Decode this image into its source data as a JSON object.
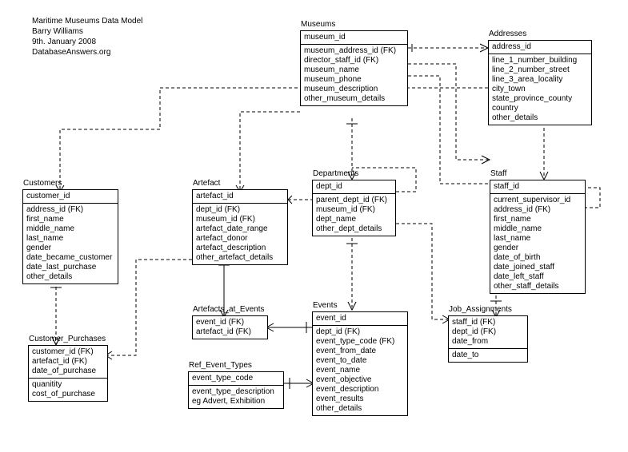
{
  "header": {
    "title": "Maritime Museums Data Model",
    "author": "Barry Williams",
    "date": "9th. January 2008",
    "site": "DatabaseAnswers.org"
  },
  "entities": {
    "museums": {
      "title": "Museums",
      "pk": [
        "museum_id"
      ],
      "attrs": [
        "museum_address_id (FK)",
        "director_staff_id (FK)",
        "museum_name",
        "museum_phone",
        "museum_description",
        "other_museum_details"
      ]
    },
    "addresses": {
      "title": "Addresses",
      "pk": [
        "address_id"
      ],
      "attrs": [
        "line_1_number_building",
        "line_2_number_street",
        "line_3_area_locality",
        "city_town",
        "state_province_county",
        "country",
        "other_details"
      ]
    },
    "customers": {
      "title": "Customers",
      "pk": [
        "customer_id"
      ],
      "attrs": [
        "address_id (FK)",
        "first_name",
        "middle_name",
        "last_name",
        "gender",
        "date_became_customer",
        "date_last_purchase",
        "other_details"
      ]
    },
    "artefact": {
      "title": "Artefact",
      "pk": [
        "artefact_id"
      ],
      "attrs": [
        "dept_id (FK)",
        "museum_id (FK)",
        "artefact_date_range",
        "artefact_donor",
        "artefact_description",
        "other_artefact_details"
      ]
    },
    "departments": {
      "title": "Departments",
      "pk": [
        "dept_id"
      ],
      "attrs": [
        "parent_dept_id (FK)",
        "museum_id (FK)",
        "dept_name",
        "other_dept_details"
      ]
    },
    "staff": {
      "title": "Staff",
      "pk": [
        "staff_id"
      ],
      "attrs": [
        "current_supervisor_id",
        "address_id (FK)",
        "first_name",
        "middle_name",
        "last_name",
        "gender",
        "date_of_birth",
        "date_joined_staff",
        "date_left_staff",
        "other_staff_details"
      ]
    },
    "artefacts_at_events": {
      "title": "Artefacts_at_Events",
      "pk": [
        "event_id (FK)",
        "artefact_id (FK)"
      ],
      "attrs": []
    },
    "events": {
      "title": "Events",
      "pk": [
        "event_id"
      ],
      "attrs": [
        "dept_id (FK)",
        "event_type_code (FK)",
        "event_from_date",
        "event_to_date",
        "event_name",
        "event_objective",
        "event_description",
        "event_results",
        "other_details"
      ]
    },
    "job_assignments": {
      "title": "Job_Assignments",
      "pk": [
        "staff_id (FK)",
        "dept_id (FK)",
        "date_from"
      ],
      "attrs": [
        "date_to"
      ]
    },
    "customer_purchases": {
      "title": "Customer_Purchases",
      "pk": [
        "customer_id (FK)",
        "artefact_id (FK)",
        "date_of_purchase"
      ],
      "attrs": [
        "quanitity",
        "cost_of_purchase"
      ]
    },
    "ref_event_types": {
      "title": "Ref_Event_Types",
      "pk": [
        "event_type_code"
      ],
      "attrs": [
        "event_type_description",
        "eg Advert, Exhibition"
      ]
    }
  }
}
